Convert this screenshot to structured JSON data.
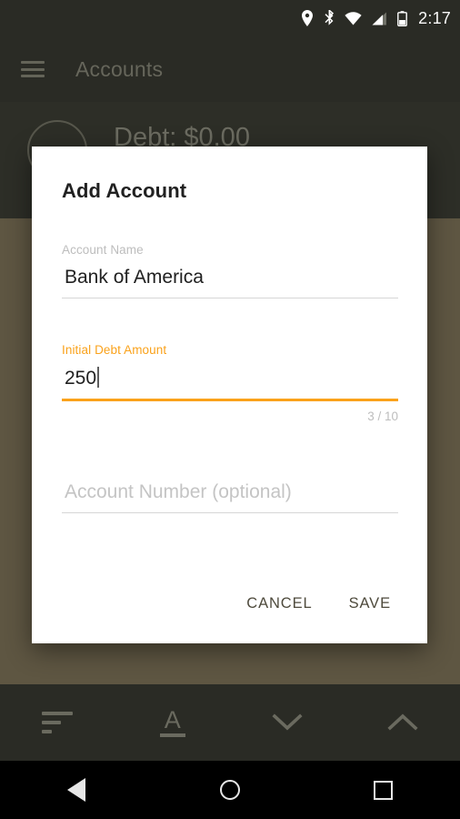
{
  "status_bar": {
    "time": "2:17",
    "icons": [
      "location-pin-icon",
      "bluetooth-icon",
      "wifi-icon",
      "cell-signal-icon",
      "battery-icon"
    ]
  },
  "app_bar": {
    "menu_icon": "hamburger-menu-icon",
    "title": "Accounts"
  },
  "background_content": {
    "debt_text": "Debt: $0.00"
  },
  "dialog": {
    "title": "Add Account",
    "fields": [
      {
        "label": "Account Name",
        "value": "Bank of America",
        "placeholder": "",
        "focused": false,
        "counter": ""
      },
      {
        "label": "Initial Debt Amount",
        "value": "250",
        "placeholder": "",
        "focused": true,
        "counter": "3 / 10"
      },
      {
        "label": "",
        "value": "",
        "placeholder": "Account Number (optional)",
        "focused": false,
        "counter": ""
      }
    ],
    "cancel_label": "CANCEL",
    "save_label": "SAVE"
  },
  "bottom_bar": {
    "buttons": [
      {
        "icon": "sort-lines-icon"
      },
      {
        "icon": "format-text-a-icon",
        "letter": "A"
      },
      {
        "icon": "chevron-down-icon"
      },
      {
        "icon": "chevron-up-icon"
      }
    ]
  },
  "nav_bar": {
    "back": "back-triangle-icon",
    "home": "home-circle-icon",
    "recents": "recents-square-icon"
  },
  "colors": {
    "accent": "#faa21b",
    "dialog_bg": "#ffffff",
    "scrim": "#5e5642",
    "bar_dark": "#2a2b25",
    "title_text": "#212121",
    "hint_text": "#bdbdbd"
  }
}
